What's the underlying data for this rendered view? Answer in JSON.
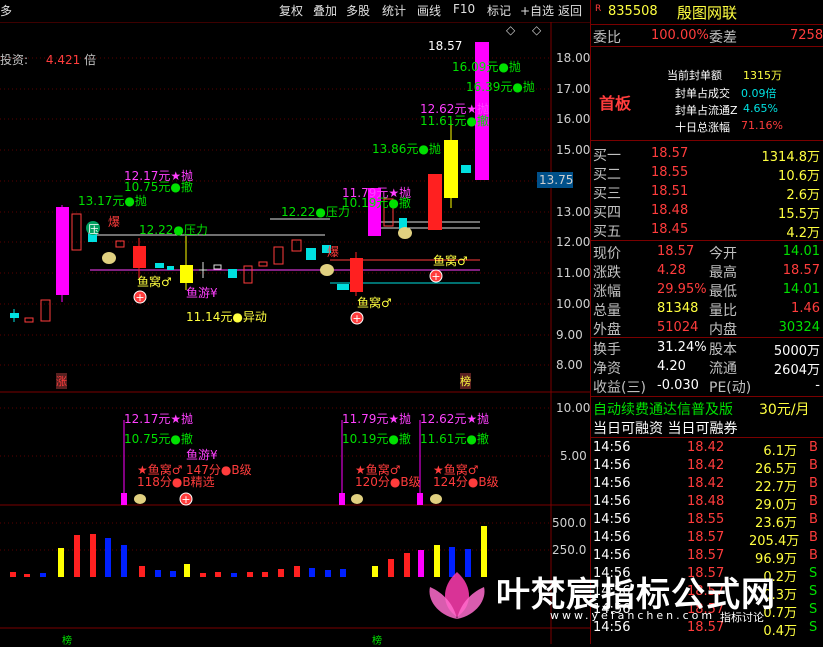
{
  "toolbar": {
    "left_label": "多",
    "buttons": [
      "复权",
      "叠加",
      "多股",
      "统计",
      "画线",
      "F10",
      "标记",
      "+自选",
      "返回"
    ]
  },
  "chart": {
    "top_info_prefix": "投资:",
    "top_info_value": "4.421",
    "top_info_unit": "倍",
    "price_ticks": [
      "18.00",
      "17.00",
      "16.00",
      "15.00",
      "14.00",
      "13.00",
      "12.00",
      "11.00",
      "10.00",
      "9.00",
      "8.00"
    ],
    "current_price_box": "13.75",
    "high_label": "18.57",
    "annotations_main": [
      {
        "text": "16.09元●抛",
        "color": "#00e000"
      },
      {
        "text": "16.39元●抛",
        "color": "#00e000"
      },
      {
        "text": "12.62元★抛",
        "color": "#ff40ff"
      },
      {
        "text": "11.61元●撤",
        "color": "#00e000"
      },
      {
        "text": "13.86元●抛",
        "color": "#00e000"
      },
      {
        "text": "11.79元★抛",
        "color": "#ff40ff"
      },
      {
        "text": "10.19元●撤",
        "color": "#00e000"
      },
      {
        "text": "12.17元★抛",
        "color": "#ff40ff"
      },
      {
        "text": "10.75元●撤",
        "color": "#00e000"
      },
      {
        "text": "13.17元●抛",
        "color": "#00e000"
      },
      {
        "text": "12.22●压力",
        "color": "#00e000"
      },
      {
        "text": "12.22●压力",
        "color": "#00e000"
      },
      {
        "text": "压",
        "color": "#00e000"
      },
      {
        "text": "爆",
        "color": "#ff3c3c"
      },
      {
        "text": "爆",
        "color": "#ff3c3c"
      },
      {
        "text": "鱼窝♂",
        "color": "#ffff40"
      },
      {
        "text": "鱼游¥",
        "color": "#ff40ff"
      },
      {
        "text": "11.14元●异动",
        "color": "#ffff40"
      },
      {
        "text": "鱼窝♂",
        "color": "#ffff40"
      },
      {
        "text": "鱼窝♂",
        "color": "#ffff40"
      },
      {
        "text": "涨",
        "color": "#ff3c3c"
      },
      {
        "text": "榜",
        "color": "#ffff40"
      }
    ],
    "sub_ticks": [
      "10.00",
      "5.00"
    ],
    "sub_annotations": [
      {
        "text": "12.17元★抛",
        "color": "#ff40ff"
      },
      {
        "text": "10.75元●撤",
        "color": "#00e000"
      },
      {
        "text": "鱼游¥",
        "color": "#ff40ff"
      },
      {
        "text": "★鱼窝♂",
        "color": "#ff3c3c"
      },
      {
        "text": "147分●B级",
        "color": "#ff3c3c"
      },
      {
        "text": "118分●B精选",
        "color": "#ff3c3c"
      },
      {
        "text": "11.79元★抛",
        "color": "#ff40ff"
      },
      {
        "text": "10.19元●撤",
        "color": "#00e000"
      },
      {
        "text": "★鱼窝♂",
        "color": "#ff3c3c"
      },
      {
        "text": "120分●B级",
        "color": "#ff3c3c"
      },
      {
        "text": "12.62元★抛",
        "color": "#ff40ff"
      },
      {
        "text": "11.61元●撤",
        "color": "#00e000"
      },
      {
        "text": "★鱼窝♂",
        "color": "#ff3c3c"
      },
      {
        "text": "124分●B级",
        "color": "#ff3c3c"
      }
    ],
    "vol_ticks": [
      "500.0",
      "250.0"
    ],
    "bottom_marks": [
      "榜",
      "榜"
    ]
  },
  "quote": {
    "r_badge": "R",
    "code": "835508",
    "name": "殷图网联",
    "weibi_label": "委比",
    "weibi_value": "100.00%",
    "weicha_label": "委差",
    "weicha_value": "7258",
    "board_label": "首板",
    "seal_rows": [
      {
        "label": "当前封单额",
        "value": "1315万"
      },
      {
        "label": "封单占成交",
        "value": "0.09倍"
      },
      {
        "label": "封单占流通Z",
        "value": "4.65%"
      },
      {
        "label": "十日总涨幅",
        "value": "71.16%"
      }
    ],
    "buy_rows": [
      {
        "label": "买一",
        "price": "18.57",
        "vol": "1314.8万"
      },
      {
        "label": "买二",
        "price": "18.55",
        "vol": "10.6万"
      },
      {
        "label": "买三",
        "price": "18.51",
        "vol": "2.6万"
      },
      {
        "label": "买四",
        "price": "18.48",
        "vol": "15.5万"
      },
      {
        "label": "买五",
        "price": "18.45",
        "vol": "4.2万"
      }
    ],
    "stats": [
      {
        "l1": "现价",
        "v1": "18.57",
        "l2": "今开",
        "v2": "14.01",
        "c1": "#ff3c3c",
        "c2": "#00e000"
      },
      {
        "l1": "涨跌",
        "v1": "4.28",
        "l2": "最高",
        "v2": "18.57",
        "c1": "#ff3c3c",
        "c2": "#ff3c3c"
      },
      {
        "l1": "涨幅",
        "v1": "29.95%",
        "l2": "最低",
        "v2": "14.01",
        "c1": "#ff3c3c",
        "c2": "#00e000"
      },
      {
        "l1": "总量",
        "v1": "81348",
        "l2": "量比",
        "v2": "1.46",
        "c1": "#ffff40",
        "c2": "#ff3c3c"
      },
      {
        "l1": "外盘",
        "v1": "51024",
        "l2": "内盘",
        "v2": "30324",
        "c1": "#ff3c3c",
        "c2": "#00e000"
      }
    ],
    "stats2": [
      {
        "l1": "换手",
        "v1": "31.24%",
        "l2": "股本",
        "v2": "5000万"
      },
      {
        "l1": "净资",
        "v1": "4.20",
        "l2": "流通",
        "v2": "2604万"
      },
      {
        "l1": "收益(三)",
        "v1": "-0.030",
        "l2": "PE(动)",
        "v2": "-"
      }
    ],
    "ad_text": "自动续费通达信普及版",
    "ad_price": "30元/月",
    "margin_label": "当日可融资 当日可融券",
    "ticks": [
      {
        "time": "14:56",
        "price": "18.42",
        "vol": "6.1万",
        "side": "B"
      },
      {
        "time": "14:56",
        "price": "18.42",
        "vol": "26.5万",
        "side": "B"
      },
      {
        "time": "14:56",
        "price": "18.42",
        "vol": "22.7万",
        "side": "B"
      },
      {
        "time": "14:56",
        "price": "18.48",
        "vol": "29.0万",
        "side": "B"
      },
      {
        "time": "14:56",
        "price": "18.55",
        "vol": "23.6万",
        "side": "B"
      },
      {
        "time": "14:56",
        "price": "18.57",
        "vol": "205.4万",
        "side": "B"
      },
      {
        "time": "14:56",
        "price": "18.57",
        "vol": "96.9万",
        "side": "B"
      },
      {
        "time": "14:56",
        "price": "18.57",
        "vol": "0.2万",
        "side": "S"
      },
      {
        "time": "14:56",
        "price": "18.57",
        "vol": "0.3万",
        "side": "S"
      },
      {
        "time": "14:56",
        "price": "18.57",
        "vol": "0.7万",
        "side": "S"
      },
      {
        "time": "14:56",
        "price": "18.57",
        "vol": "0.4万",
        "side": "S"
      }
    ]
  },
  "watermark": {
    "title": "叶梵宸指标公式网",
    "url": "www.yefanchen.com",
    "sub": "指标讨论"
  },
  "colors": {
    "up": "#ff3c3c",
    "down": "#00e000",
    "magenta": "#ff00ff",
    "cyan": "#00e0e0",
    "yellow": "#ffff00",
    "grid": "#7a0000"
  }
}
